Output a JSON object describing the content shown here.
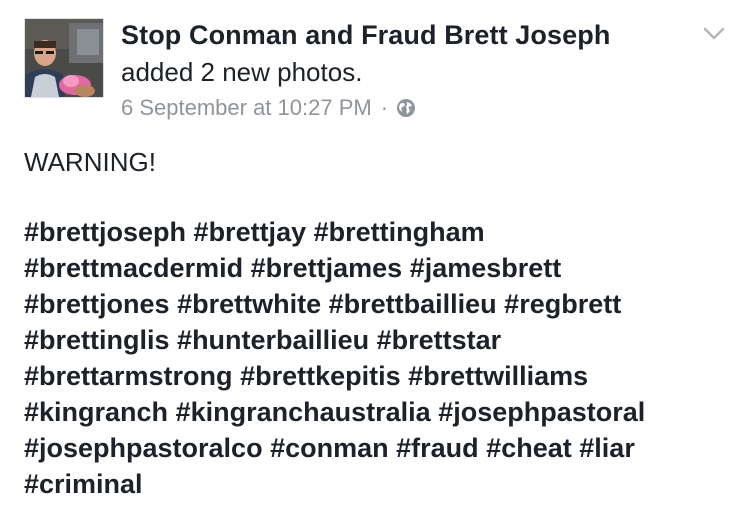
{
  "post": {
    "author": "Stop Conman and Fraud Brett Joseph",
    "action": "added 2 new photos.",
    "timestamp": "6 September at 10:27 PM",
    "separator": "·",
    "audience_icon": "globe-icon",
    "menu_icon": "chevron-down-icon",
    "body": "WARNING!",
    "hashtag_lines": [
      [
        "#brettjoseph",
        "#brettjay",
        "#brettingham"
      ],
      [
        "#brettmacdermid",
        "#brettjames",
        "#jamesbrett"
      ],
      [
        "#brettjones",
        "#brettwhite",
        "#brettbaillieu",
        "#regbrett"
      ],
      [
        "#brettinglis",
        "#hunterbaillieu",
        "#brettstar"
      ],
      [
        "#brettarmstrong",
        "#brettkepitis",
        "#brettwilliams"
      ],
      [
        "#kingranch",
        "#kingranchaustralia",
        "#josephpastoral"
      ],
      [
        "#josephpastoralco",
        "#conman",
        "#fraud",
        "#cheat",
        "#liar"
      ],
      [
        "#criminal"
      ]
    ]
  },
  "colors": {
    "text": "#1d2129",
    "meta": "#90949c",
    "border": "#dddfe2"
  }
}
